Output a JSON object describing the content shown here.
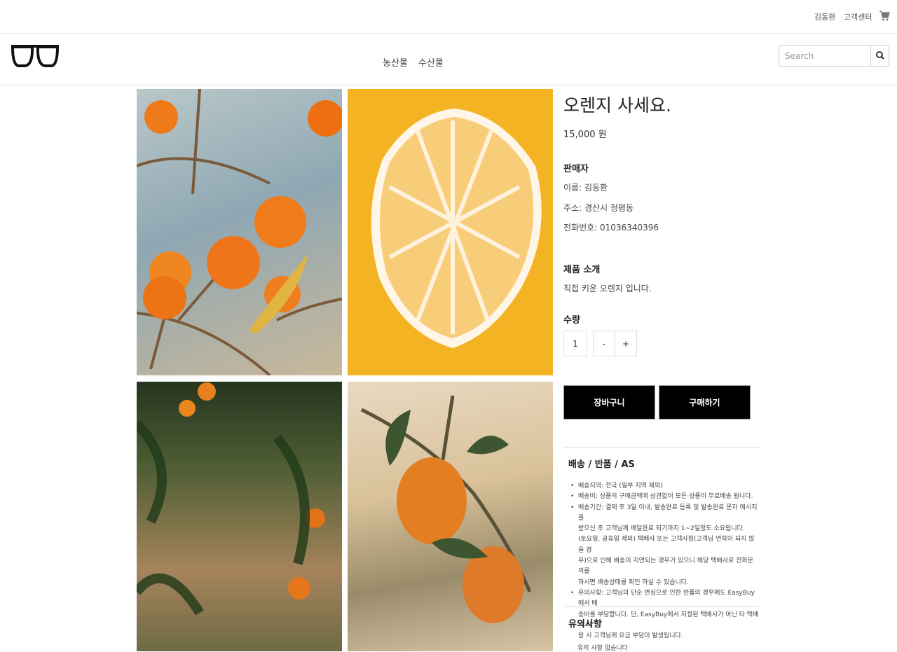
{
  "topbar": {
    "user_name": "김동환",
    "customer_center": "고객센터",
    "cart_icon": "cart-icon"
  },
  "navbar": {
    "logo_icon": "glasses-logo-icon",
    "links": [
      "농산물",
      "수산물"
    ],
    "search": {
      "placeholder": "Search",
      "button_icon": "search-icon"
    }
  },
  "gallery": {
    "images": [
      "orange-tree-branch-photo",
      "halved-orange-photo",
      "orange-orchard-photo",
      "oranges-on-branch-photo"
    ]
  },
  "product": {
    "title": "오렌지 사세요.",
    "price": "15,000 원",
    "seller": {
      "heading": "판매자",
      "name": "이름: 김동환",
      "address": "주소: 경산시 정평동",
      "phone": "전화번호: 01036340396"
    },
    "intro": {
      "heading": "제품 소개",
      "text": "직접 키운 오렌지 입니다."
    },
    "quantity": {
      "heading": "수량",
      "value": "1",
      "minus": "-",
      "plus": "+"
    },
    "actions": {
      "cart": "장바구니",
      "buy": "구매하기"
    }
  },
  "shipping": {
    "heading": "배송 / 반품 / AS",
    "items": [
      {
        "lines": [
          "배송지역: 전국 (일부 지역 제외)"
        ]
      },
      {
        "lines": [
          "배송비: 상품의 구매금액에 상관없이 모든 상품이 무료배송 됩니다."
        ]
      },
      {
        "lines": [
          "배송기간: 결제 후 3일 이내, 발송완료 등록 및 발송완료 문자 메시지를",
          "받으신 후 고객님께 배달완료 되기까지 1~2일정도 소요됩니다.",
          "(토요일, 공휴일 제외) 택배사 또는 고객사정(고객님 연락이 되지 않을 경",
          "우)으로 인해 배송이 지연되는 경우가 있으니 해당 택배사로 전화문의를",
          "하시면 배송상태를 확인 하실 수 있습니다."
        ]
      },
      {
        "lines": [
          "유의사항: 고객님의 단순 변심으로 인한 반품의 경우에도 EasyBuy에서 배",
          "송비를 부담합니다. 단, EasyBuy에서 지정된 택배사가 아닌 타 택배사 이",
          "용 시 고객님께 요금 부담이 발생됩니다."
        ]
      }
    ]
  },
  "notice": {
    "heading": "유의사항",
    "text": "유의 사항 없습니다"
  }
}
